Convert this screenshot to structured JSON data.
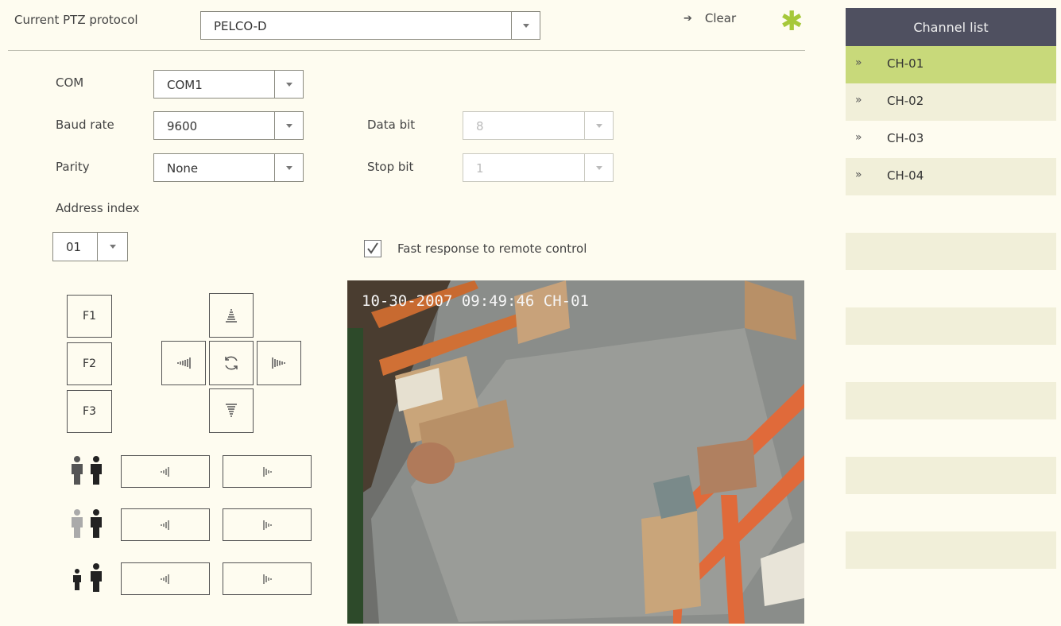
{
  "header": {
    "protocol_label": "Current PTZ protocol",
    "protocol_value": "PELCO-D",
    "clear_label": "Clear"
  },
  "settings": {
    "com_label": "COM",
    "com_value": "COM1",
    "baud_label": "Baud rate",
    "baud_value": "9600",
    "parity_label": "Parity",
    "parity_value": "None",
    "databit_label": "Data bit",
    "databit_value": "8",
    "stopbit_label": "Stop bit",
    "stopbit_value": "1",
    "address_label": "Address index",
    "address_value": "01",
    "fast_response_label": "Fast response to remote control",
    "fast_response_checked": true
  },
  "controls": {
    "f1": "F1",
    "f2": "F2",
    "f3": "F3"
  },
  "video": {
    "overlay": "10-30-2007 09:49:46 CH-01"
  },
  "channels": {
    "title": "Channel list",
    "items": [
      {
        "label": "CH-01",
        "selected": true
      },
      {
        "label": "CH-02",
        "selected": false
      },
      {
        "label": "CH-03",
        "selected": false
      },
      {
        "label": "CH-04",
        "selected": false
      }
    ]
  },
  "colors": {
    "accent_star": "#a6c83a",
    "selected_row": "#c8d97a",
    "header_bg": "#4f5060",
    "page_bg": "#fefcf0"
  }
}
